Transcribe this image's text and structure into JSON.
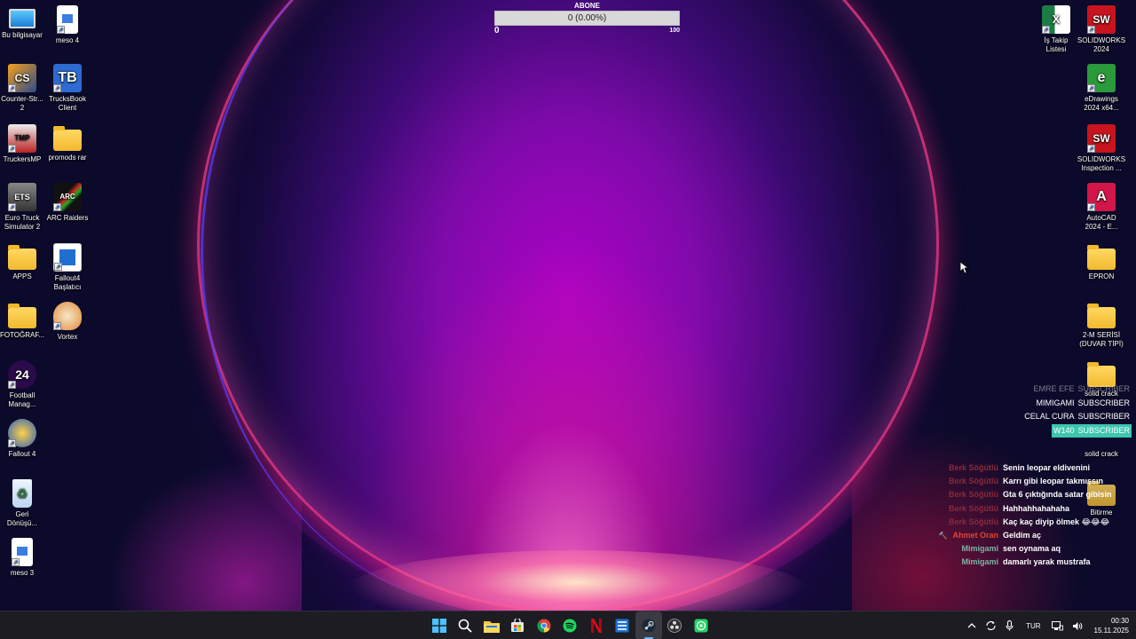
{
  "desktop": {
    "left_icons": [
      {
        "label": "Bu bilgisayar",
        "icon": "monitor-icon"
      },
      {
        "label": "meso 4",
        "icon": "image-file-icon"
      },
      {
        "label": "Counter-Str...\n2",
        "icon": "counter-strike-icon"
      },
      {
        "label": "TrucksBook\nClient",
        "icon": "trucksbook-icon"
      },
      {
        "label": "TruckersMP",
        "icon": "truckersmp-icon"
      },
      {
        "label": "promods rar",
        "icon": "folder-icon"
      },
      {
        "label": "Euro Truck\nSimulator 2",
        "icon": "euro-truck-icon"
      },
      {
        "label": "ARC Raiders",
        "icon": "arc-raiders-icon"
      },
      {
        "label": "APPS",
        "icon": "folder-icon"
      },
      {
        "label": "Fallout4\nBaşlatıcı",
        "icon": "fallout4-launcher-icon"
      },
      {
        "label": "FOTOĞRAF...",
        "icon": "folder-icon"
      },
      {
        "label": "Vortex",
        "icon": "vortex-icon"
      },
      {
        "label": "Football\nManag...",
        "icon": "football-manager-icon"
      },
      {
        "label": "Fallout 4",
        "icon": "fallout4-icon"
      },
      {
        "label": "Geri\nDönüşü...",
        "icon": "recycle-bin-icon"
      },
      {
        "label": "meso 3",
        "icon": "image-file-icon"
      }
    ],
    "right_icons": [
      {
        "label": "İş Takip\nListesi",
        "icon": "excel-icon"
      },
      {
        "label": "SOLIDWORKS\n2024",
        "icon": "solidworks-icon"
      },
      {
        "label": "eDrawings\n2024 x64...",
        "icon": "edrawings-icon"
      },
      {
        "label": "SOLIDWORKS\nInspection ...",
        "icon": "solidworks-inspection-icon"
      },
      {
        "label": "AutoCAD\n2024 - E...",
        "icon": "autocad-icon"
      },
      {
        "label": "EPRON",
        "icon": "folder-icon"
      },
      {
        "label": "2-M SERİSİ\n(DUVAR TİPİ)",
        "icon": "folder-icon"
      },
      {
        "label": "solid crack",
        "icon": "folder-icon"
      },
      {
        "label": "solid crack",
        "icon": "folder-icon"
      },
      {
        "label": "Bitirme",
        "icon": "folder-icon"
      }
    ]
  },
  "subscriber_widget": {
    "title": "ABONE",
    "progress_text": "0 (0.00%)",
    "progress_fraction": 0.0,
    "min_label": "0",
    "max_label": "100"
  },
  "alerts": [
    {
      "name": "EMRE EFE",
      "tag": "SUBSCRIBER",
      "state": "faded"
    },
    {
      "name": "MIMIGAMI",
      "tag": "SUBSCRIBER",
      "state": "normal"
    },
    {
      "name": "CELAL CURA",
      "tag": "SUBSCRIBER",
      "state": "normal"
    },
    {
      "name": "W140",
      "tag": "SUBSCRIBER",
      "state": "highlight"
    }
  ],
  "chat": [
    {
      "user": "Berk Söğütlü",
      "text": "Senin leopar eldivenini",
      "color": "#8a2a3a",
      "prefix": ""
    },
    {
      "user": "Berk Söğütlü",
      "text": "Karrı gibi leopar takmışsın",
      "color": "#8a2a3a",
      "prefix": ""
    },
    {
      "user": "Berk Söğütlü",
      "text": "Gta 6 çıktığında satar gibisin",
      "color": "#8a2a3a",
      "prefix": ""
    },
    {
      "user": "Berk Söğütlü",
      "text": "Hahhahhahahaha",
      "color": "#8a2a3a",
      "prefix": ""
    },
    {
      "user": "Berk Söğütlü",
      "text": "Kaç kaç diyip ölmek 😂😂😂",
      "color": "#8a2a3a",
      "prefix": ""
    },
    {
      "user": "Ahmet Oran",
      "text": "Geldim aç",
      "color": "#e0452f",
      "prefix": "🔨"
    },
    {
      "user": "Mimigami",
      "text": "sen oynama aq",
      "color": "#7fb3a8",
      "prefix": ""
    },
    {
      "user": "Mimigami",
      "text": "damarlı yarak mustrafa",
      "color": "#7fb3a8",
      "prefix": ""
    }
  ],
  "taskbar": {
    "apps": [
      {
        "name": "start-button",
        "icon": "windows-logo-icon"
      },
      {
        "name": "search-button",
        "icon": "search-icon"
      },
      {
        "name": "file-explorer-button",
        "icon": "folder-icon"
      },
      {
        "name": "store-button",
        "icon": "store-icon"
      },
      {
        "name": "chrome-button",
        "icon": "chrome-icon"
      },
      {
        "name": "spotify-button",
        "icon": "spotify-icon"
      },
      {
        "name": "netflix-button",
        "icon": "netflix-icon"
      },
      {
        "name": "app-button",
        "icon": "blue-app-icon"
      },
      {
        "name": "steam-button",
        "icon": "steam-icon"
      },
      {
        "name": "obs-button",
        "icon": "obs-icon"
      },
      {
        "name": "whatsapp-button",
        "icon": "whatsapp-icon"
      }
    ],
    "tray": {
      "language": "TUR",
      "time": "00:30",
      "date": "15.11.2025"
    }
  },
  "colors": {
    "wallpaper_bg": "#0b0a2a",
    "alert_highlight": "#3cc6b0",
    "taskbar": "#1c1c22"
  }
}
